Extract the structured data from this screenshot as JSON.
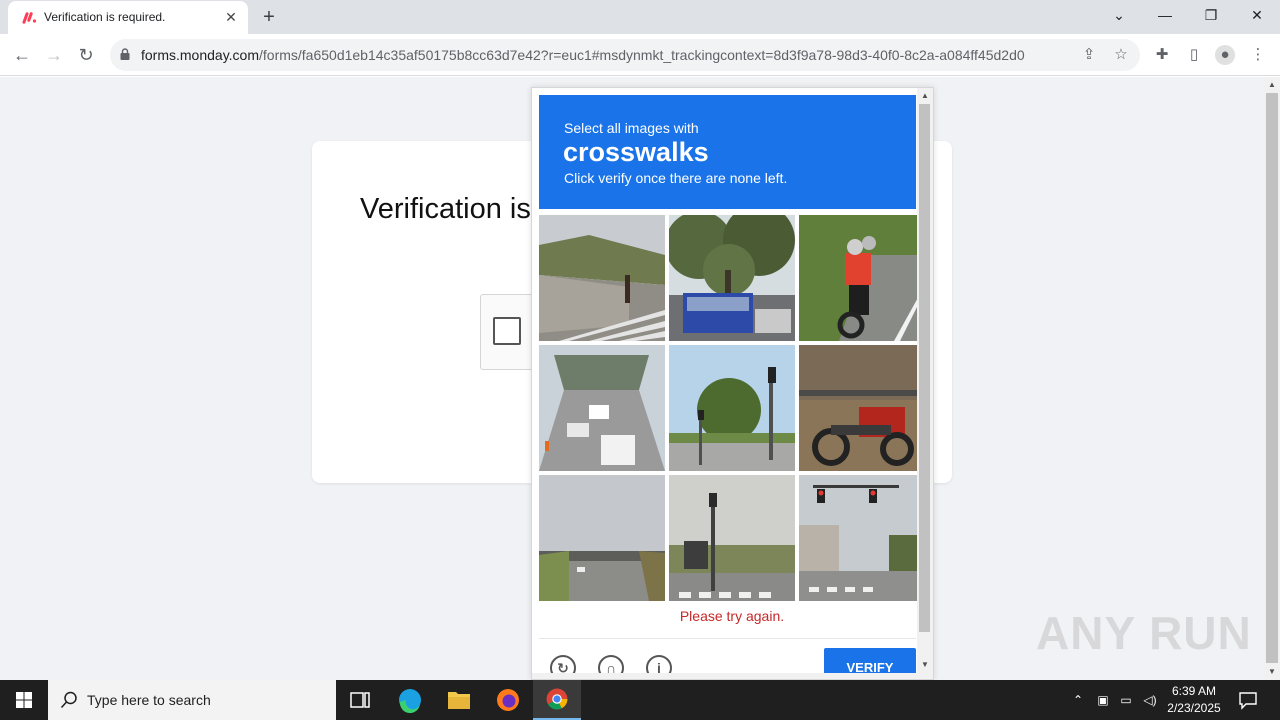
{
  "browser": {
    "tab_title": "Verification is required.",
    "url_host": "forms.monday.com",
    "url_path": "/forms/fa650d1eb14c35af50175b8cc63d7e42?r=euc1#msdynmkt_trackingcontext=8d3f9a78-98d3-40f0-8c2a-a084ff45d2d0"
  },
  "page": {
    "title": "Verification is required."
  },
  "challenge": {
    "prompt_line1": "Select all images with",
    "prompt_keyword": "crosswalks",
    "prompt_line3": "Click verify once there are none left.",
    "tiles": [
      {
        "label": "Tile 1"
      },
      {
        "label": "Tile 2"
      },
      {
        "label": "Tile 3"
      },
      {
        "label": "Tile 4"
      },
      {
        "label": "Tile 5"
      },
      {
        "label": "Tile 6"
      },
      {
        "label": "Tile 7"
      },
      {
        "label": "Tile 8"
      },
      {
        "label": "Tile 9"
      }
    ],
    "error_text": "Please try again.",
    "verify_label": "VERIFY",
    "accent_color": "#1a73e8",
    "error_color": "#c62828"
  },
  "watermark": "ANY RUN",
  "taskbar": {
    "search_placeholder": "Type here to search",
    "time": "6:39 AM",
    "date": "2/23/2025"
  }
}
